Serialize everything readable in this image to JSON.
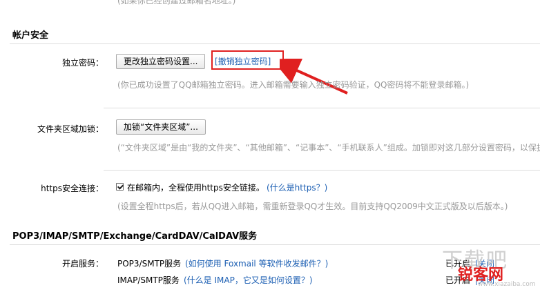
{
  "top_hint": "(如果你已经创建过邮箱名地址。)",
  "account_security": {
    "title": "帐户安全",
    "independent_password": {
      "label": "独立密码：",
      "change_button": "更改独立密码设置...",
      "revoke_link": "[撤销独立密码]",
      "hint": "(你已成功设置了QQ邮箱独立密码。进入邮箱需要输入独立密码验证，QQ密码将不能登录邮箱。)"
    },
    "folder_lock": {
      "label": "文件夹区域加锁：",
      "button": "加锁“文件夹区域”...",
      "hint": "(“文件夹区域”是由“我的文件夹”、“其他邮箱”、“记事本”、“手机联系人”组成。加锁即对这几部分设置密码，以保护"
    },
    "https": {
      "label": "https安全连接：",
      "checked": true,
      "checkbox_text": "在邮箱内，全程使用https安全链接。",
      "link": "(什么是https？)",
      "hint": "(设置全程https后，若从QQ进入邮箱，需重新登录QQ才生效。目前支持QQ2009中文正式版及以后版本。)"
    }
  },
  "services": {
    "title": "POP3/IMAP/SMTP/Exchange/CardDAV/CalDAV服务",
    "enable_label": "开启服务：",
    "items": [
      {
        "name": "POP3/SMTP服务",
        "help": "(如何使用 Foxmail 等软件收发邮件？)",
        "status": "已开启",
        "action": "|关闭"
      },
      {
        "name": "IMAP/SMTP服务",
        "help": "(什么是 IMAP，它又是如何设置？)",
        "status": "已开启",
        "action": "|关闭"
      }
    ]
  },
  "watermark": {
    "brand": "锐客网",
    "ghost": "下载吧",
    "small": "www.xiazaiba.com"
  },
  "colors": {
    "accent_red": "#e02020",
    "link_blue": "#1c5fb3",
    "hint_gray": "#999999",
    "divider": "#dcdcdc"
  }
}
